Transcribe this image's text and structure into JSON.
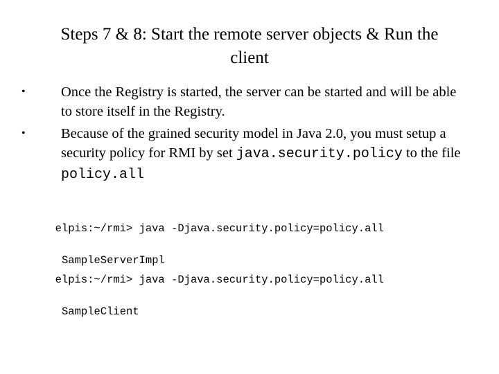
{
  "slide": {
    "title": "Steps 7 & 8: Start the remote server objects & Run the client",
    "bullets": [
      {
        "text": "Once the Registry is started, the server can be started and will be able to store itself in the Registry."
      },
      {
        "text_before": "Because of the grained security model in Java 2.0, you must setup a security policy for RMI by set ",
        "code1": "java.security.policy",
        "text_middle": " to the file ",
        "code2": "policy.all"
      }
    ],
    "bullet_glyph": "•",
    "commands": [
      {
        "line1": "elpis:~/rmi> java -Djava.security.policy=policy.all",
        "line2": "SampleServerImpl"
      },
      {
        "line1": "elpis:~/rmi> java -Djava.security.policy=policy.all",
        "line2": "SampleClient"
      }
    ]
  }
}
